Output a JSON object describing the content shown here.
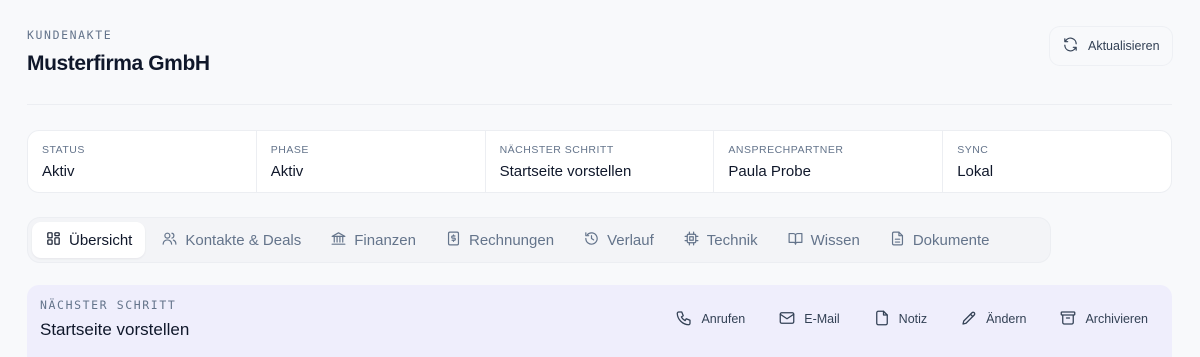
{
  "header": {
    "eyebrow": "KUNDENAKTE",
    "title": "Musterfirma GmbH",
    "refresh_label": "Aktualisieren",
    "refresh_icon": "refresh-icon"
  },
  "status": [
    {
      "label": "STATUS",
      "value": "Aktiv"
    },
    {
      "label": "PHASE",
      "value": "Aktiv"
    },
    {
      "label": "NÄCHSTER SCHRITT",
      "value": "Startseite vorstellen"
    },
    {
      "label": "ANSPRECHPARTNER",
      "value": "Paula Probe"
    },
    {
      "label": "SYNC",
      "value": "Lokal"
    }
  ],
  "tabs": [
    {
      "label": "Übersicht",
      "icon": "grid-icon",
      "active": true
    },
    {
      "label": "Kontakte & Deals",
      "icon": "users-icon"
    },
    {
      "label": "Finanzen",
      "icon": "bank-icon"
    },
    {
      "label": "Rechnungen",
      "icon": "invoice-icon"
    },
    {
      "label": "Verlauf",
      "icon": "history-icon"
    },
    {
      "label": "Technik",
      "icon": "chip-icon"
    },
    {
      "label": "Wissen",
      "icon": "book-icon"
    },
    {
      "label": "Dokumente",
      "icon": "document-icon"
    }
  ],
  "next_step": {
    "eyebrow": "NÄCHSTER SCHRITT",
    "title": "Startseite vorstellen",
    "actions": [
      {
        "label": "Anrufen",
        "icon": "phone-icon"
      },
      {
        "label": "E-Mail",
        "icon": "mail-icon"
      },
      {
        "label": "Notiz",
        "icon": "note-icon"
      },
      {
        "label": "Ändern",
        "icon": "pencil-icon"
      },
      {
        "label": "Archivieren",
        "icon": "archive-icon"
      }
    ]
  },
  "colors": {
    "background": "#f8f9fb",
    "accent_panel": "#efeefc",
    "text": "#0f172a",
    "muted": "#64748b"
  }
}
